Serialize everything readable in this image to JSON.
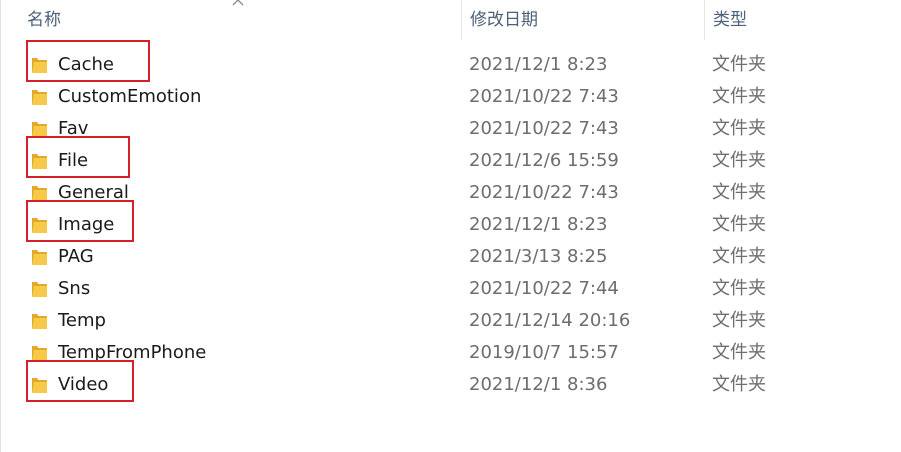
{
  "columns": {
    "name": "名称",
    "date": "修改日期",
    "type": "类型"
  },
  "files": [
    {
      "name": "Cache",
      "date": "2021/12/1 8:23",
      "type": "文件夹",
      "highlighted": true
    },
    {
      "name": "CustomEmotion",
      "date": "2021/10/22 7:43",
      "type": "文件夹",
      "highlighted": false
    },
    {
      "name": "Fav",
      "date": "2021/10/22 7:43",
      "type": "文件夹",
      "highlighted": false
    },
    {
      "name": "File",
      "date": "2021/12/6 15:59",
      "type": "文件夹",
      "highlighted": true
    },
    {
      "name": "General",
      "date": "2021/10/22 7:43",
      "type": "文件夹",
      "highlighted": false
    },
    {
      "name": "Image",
      "date": "2021/12/1 8:23",
      "type": "文件夹",
      "highlighted": true
    },
    {
      "name": "PAG",
      "date": "2021/3/13 8:25",
      "type": "文件夹",
      "highlighted": false
    },
    {
      "name": "Sns",
      "date": "2021/10/22 7:44",
      "type": "文件夹",
      "highlighted": false
    },
    {
      "name": "Temp",
      "date": "2021/12/14 20:16",
      "type": "文件夹",
      "highlighted": false
    },
    {
      "name": "TempFromPhone",
      "date": "2019/10/7 15:57",
      "type": "文件夹",
      "highlighted": false
    },
    {
      "name": "Video",
      "date": "2021/12/1 8:36",
      "type": "文件夹",
      "highlighted": true
    }
  ],
  "colors": {
    "folder": "#f8c847",
    "folder_dark": "#e3a92a",
    "highlight": "#d4202a"
  },
  "icons": {
    "folder": "folder-icon",
    "sort": "sort-up-icon"
  }
}
